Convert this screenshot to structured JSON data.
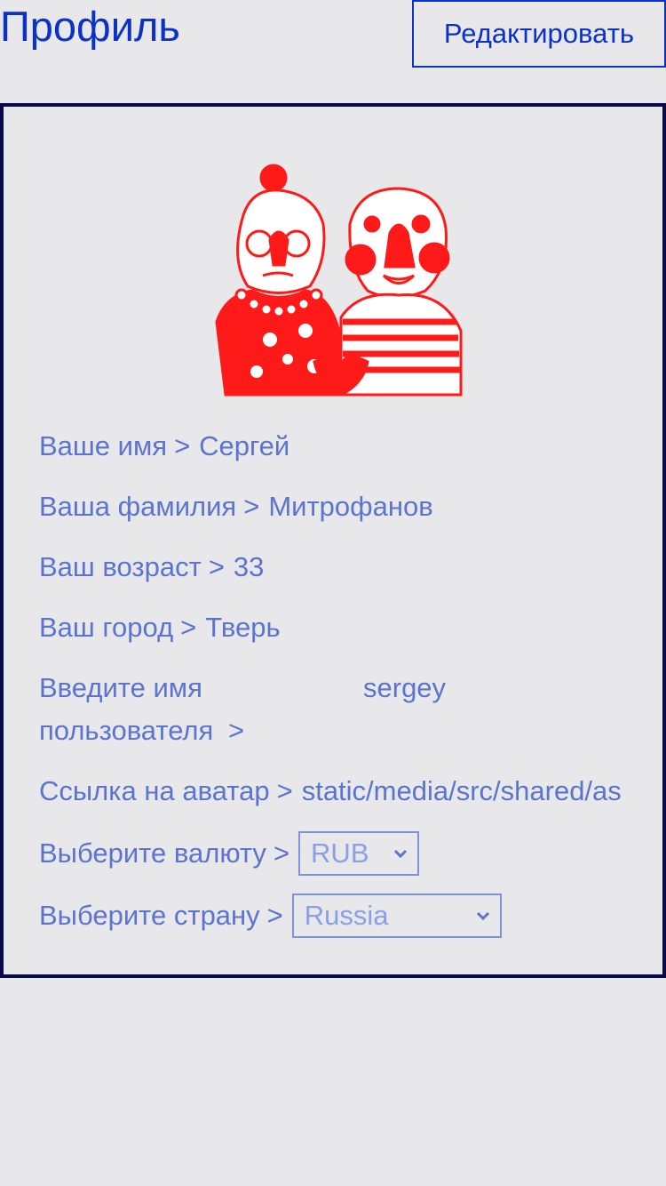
{
  "header": {
    "title": "Профиль",
    "edit_label": "Редактировать"
  },
  "profile": {
    "separator": ">",
    "fields": {
      "first_name": {
        "label": "Ваше имя",
        "value": "Сергей"
      },
      "last_name": {
        "label": "Ваша фамилия",
        "value": "Митрофанов"
      },
      "age": {
        "label": "Ваш возраст",
        "value": "33"
      },
      "city": {
        "label": "Ваш город",
        "value": "Тверь"
      },
      "username": {
        "label": "Введите имя пользователя",
        "value": "sergey"
      },
      "avatar_link": {
        "label": "Ссылка на аватар",
        "value": "static/media/src/shared/as"
      },
      "currency": {
        "label": "Выберите валюту",
        "value": "RUB"
      },
      "country": {
        "label": "Выберите страну",
        "value": "Russia"
      }
    }
  },
  "colors": {
    "accent": "#0b32c8",
    "text": "#5a74d0",
    "card_border": "#0a0a4a",
    "background": "#e8e7ea",
    "avatar": "#ff1a1a"
  }
}
